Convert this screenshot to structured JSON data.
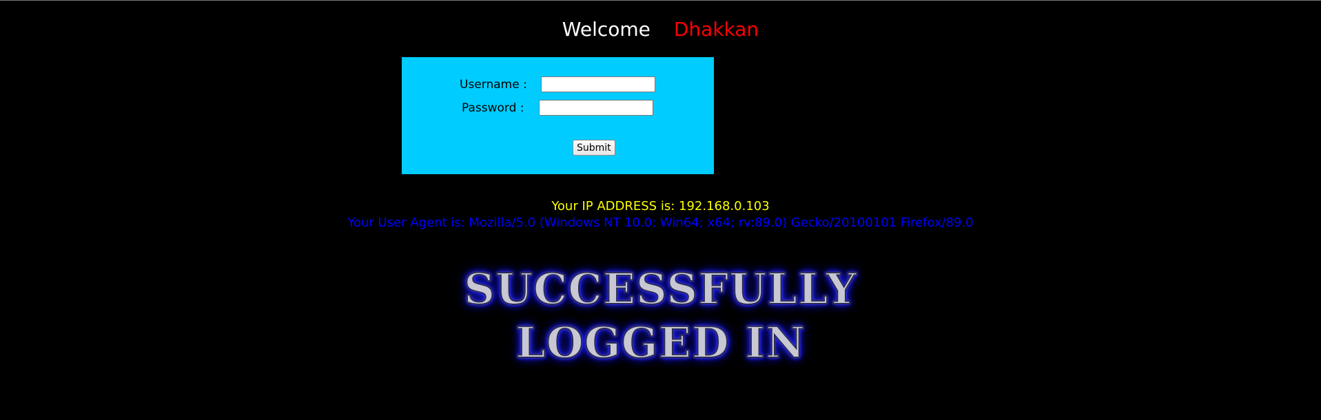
{
  "header": {
    "welcome": "Welcome",
    "user_name": "Dhakkan"
  },
  "login_form": {
    "username_label": "Username :",
    "password_label": "Password :",
    "username_value": "",
    "password_value": "",
    "submit_label": "Submit"
  },
  "info": {
    "ip_line": "Your IP ADDRESS is: 192.168.0.103",
    "user_agent_line": "Your User Agent is: Mozilla/5.0 (Windows NT 10.0; Win64; x64; rv:89.0) Gecko/20100101 Firefox/89.0"
  },
  "banner": {
    "line1": "SUCCESSFULLY",
    "line2": "LOGGED IN"
  },
  "colors": {
    "background": "#000000",
    "panel": "#00ccff",
    "welcome": "#ffffff",
    "user_name": "#ff0000",
    "ip_text": "#ffff00",
    "user_agent_text": "#0000ff"
  }
}
